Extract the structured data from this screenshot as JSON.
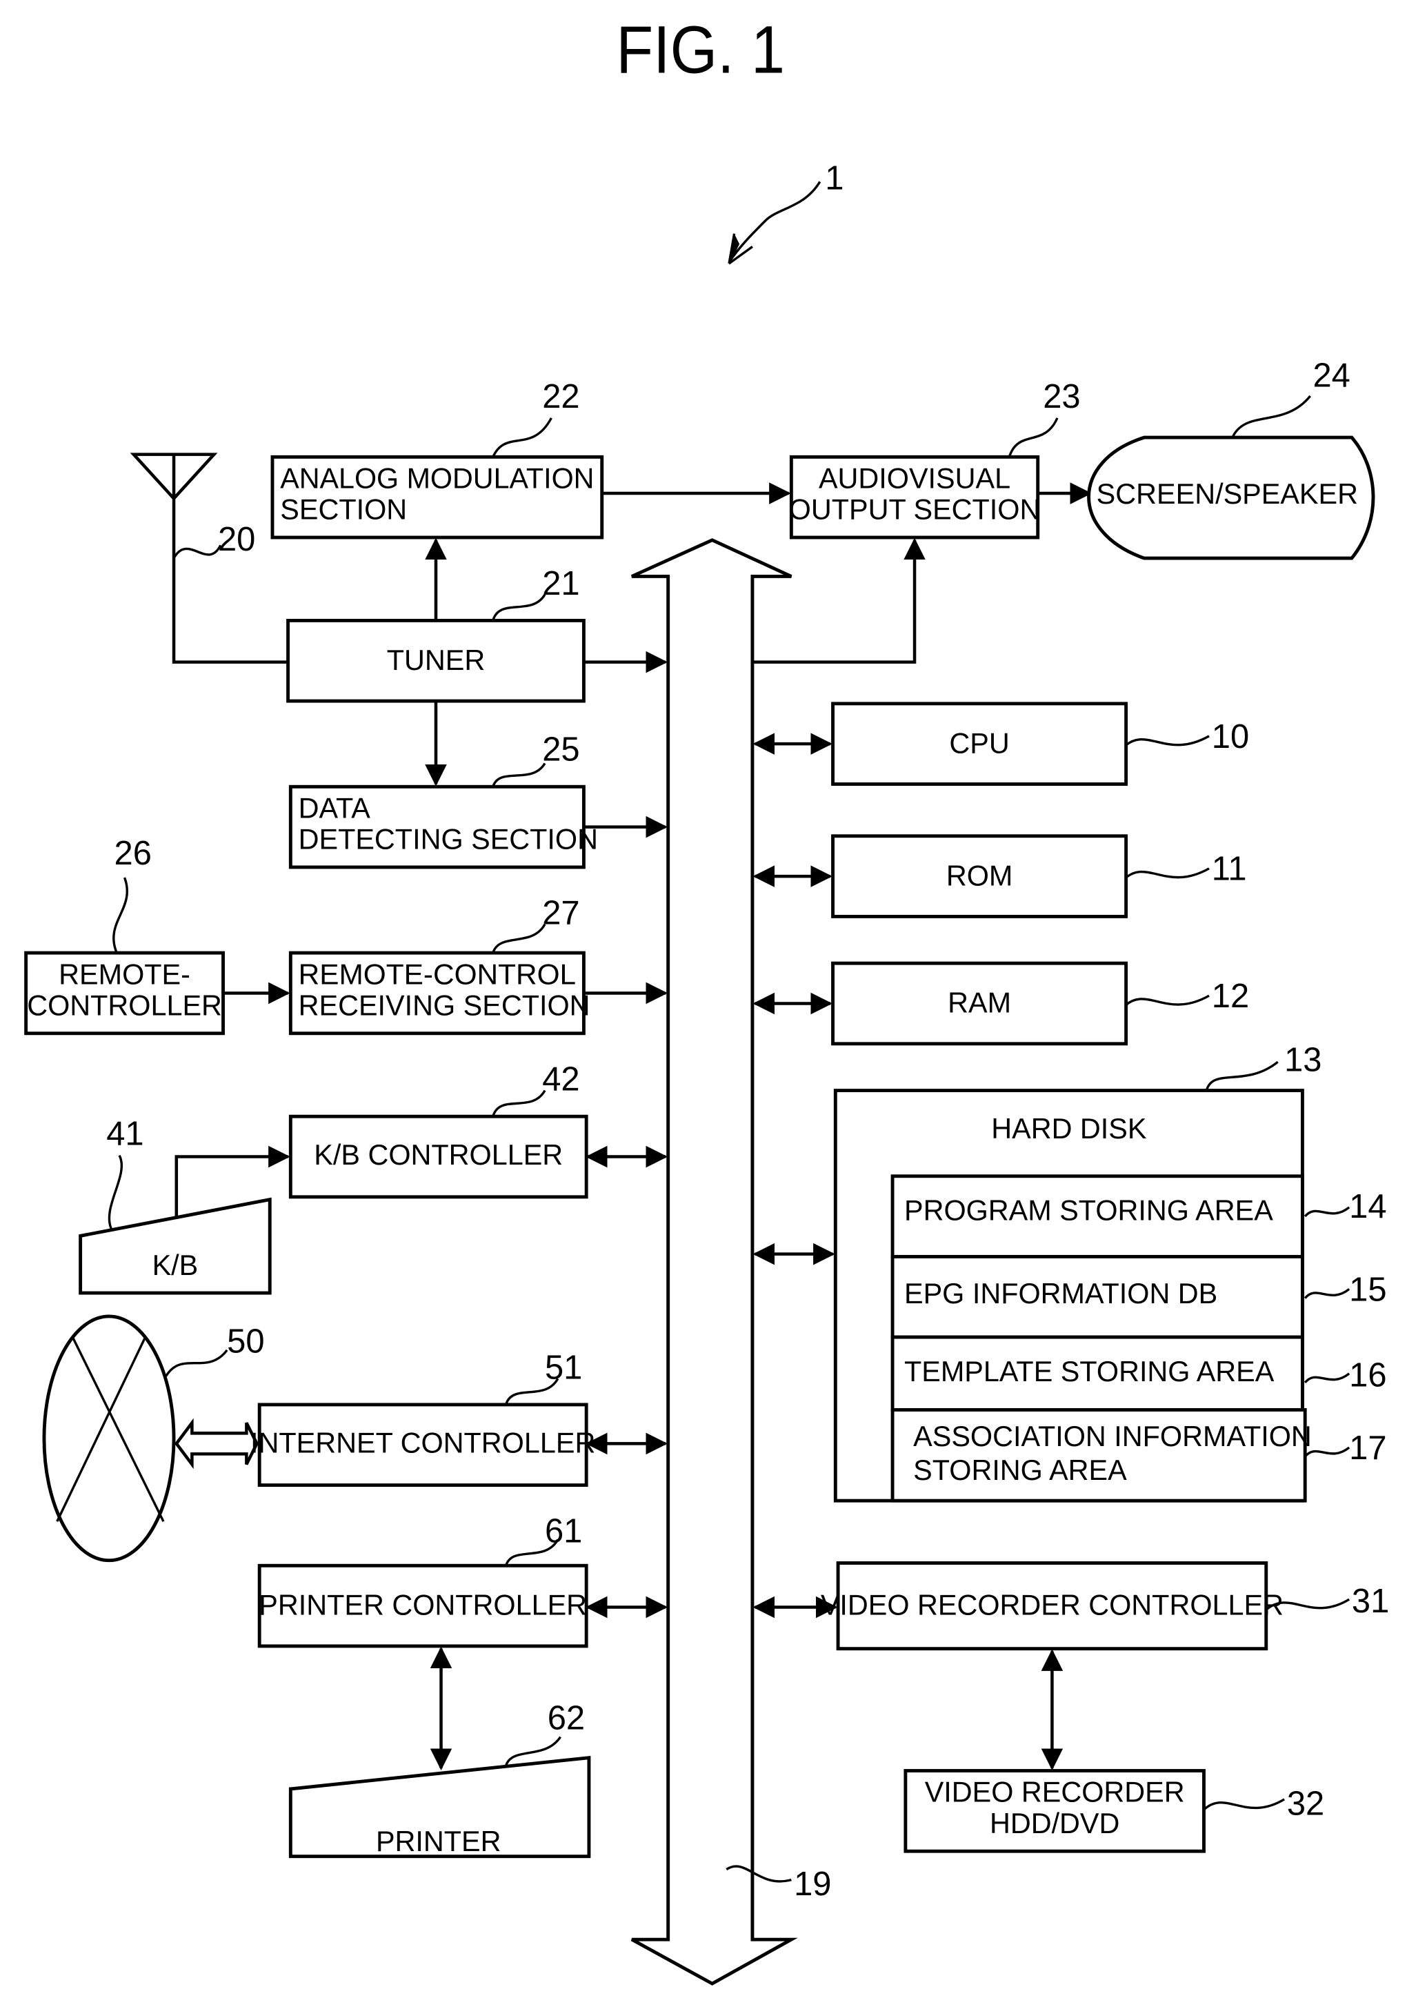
{
  "figure": {
    "title": "FIG. 1",
    "system_ref": "1",
    "bus_ref": "19"
  },
  "blocks": {
    "analog": {
      "ref": "22",
      "line1": "ANALOG  MODULATION",
      "line2": "SECTION"
    },
    "audiovisual": {
      "ref": "23",
      "line1": "AUDIOVISUAL",
      "line2": "OUTPUT SECTION"
    },
    "screen": {
      "ref": "24",
      "label": "SCREEN/SPEAKER"
    },
    "antenna": {
      "ref": "20"
    },
    "tuner": {
      "ref": "21",
      "label": "TUNER"
    },
    "data_detect": {
      "ref": "25",
      "line1": "DATA",
      "line2": "DETECTING SECTION"
    },
    "remote": {
      "ref": "26",
      "line1": "REMOTE-",
      "line2": "CONTROLLER"
    },
    "remote_recv": {
      "ref": "27",
      "line1": "REMOTE-CONTROL",
      "line2": "RECEIVING SECTION"
    },
    "kb_ctrl": {
      "ref": "42",
      "label": "K/B CONTROLLER"
    },
    "kb": {
      "ref": "41",
      "label": "K/B"
    },
    "internet": {
      "ref": "50"
    },
    "internet_ctrl": {
      "ref": "51",
      "label": "INTERNET CONTROLLER"
    },
    "printer_ctrl": {
      "ref": "61",
      "label": "PRINTER CONTROLLER"
    },
    "printer": {
      "ref": "62",
      "label": "PRINTER"
    },
    "cpu": {
      "ref": "10",
      "label": "CPU"
    },
    "rom": {
      "ref": "11",
      "label": "ROM"
    },
    "ram": {
      "ref": "12",
      "label": "RAM"
    },
    "hard_disk": {
      "ref": "13",
      "label": "HARD DISK"
    },
    "program_area": {
      "ref": "14",
      "label": "PROGRAM STORING AREA"
    },
    "epg_db": {
      "ref": "15",
      "label": "EPG INFORMATION DB"
    },
    "template_area": {
      "ref": "16",
      "label": "TEMPLATE STORING AREA"
    },
    "assoc_area": {
      "ref": "17",
      "line1": "ASSOCIATION INFORMATION",
      "line2": "STORING AREA"
    },
    "vr_ctrl": {
      "ref": "31",
      "label": "VIDEO RECORDER CONTROLLER"
    },
    "vr": {
      "ref": "32",
      "line1": "VIDEO RECORDER",
      "line2": "HDD/DVD"
    }
  }
}
